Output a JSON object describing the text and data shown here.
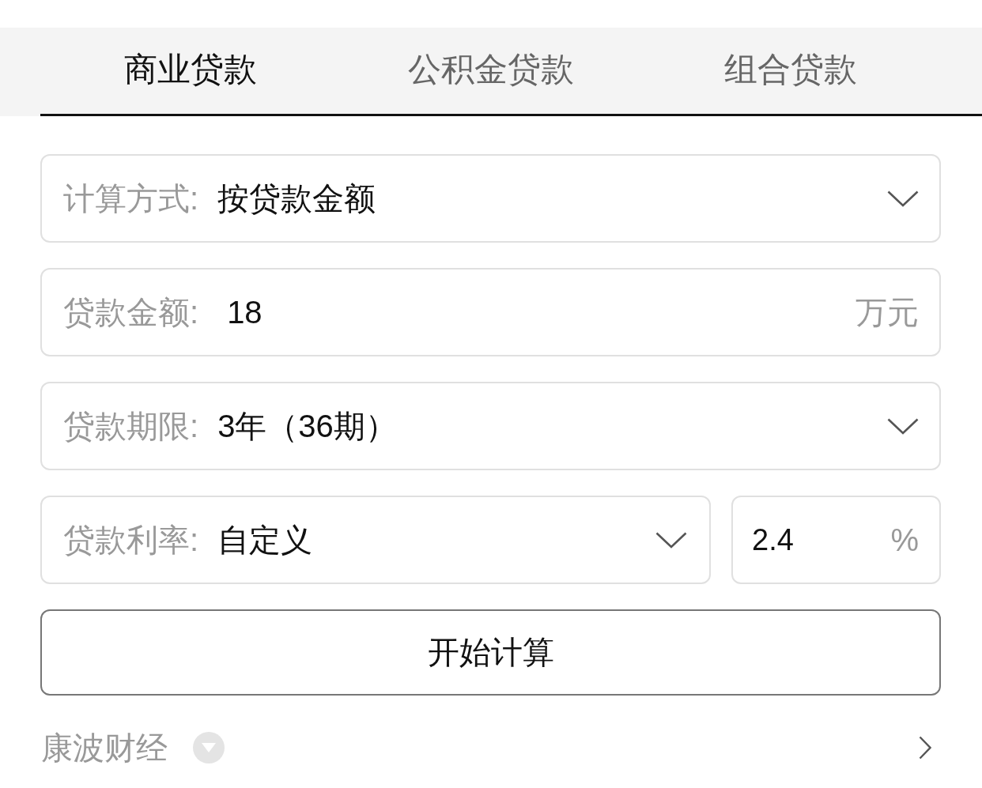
{
  "tabs": [
    {
      "label": "商业贷款",
      "selected": true
    },
    {
      "label": "公积金贷款",
      "selected": false
    },
    {
      "label": "组合贷款",
      "selected": false
    }
  ],
  "form": {
    "fields": [
      {
        "kind": "select",
        "label": "计算方式:",
        "value": "按贷款金额"
      },
      {
        "kind": "input",
        "label": "贷款金额:",
        "value": "18",
        "unit": "万元"
      },
      {
        "kind": "select",
        "label": "贷款期限:",
        "value": "3年（36期）"
      }
    ],
    "rate": {
      "label": "贷款利率:",
      "value": "自定义",
      "custom_value": "2.4",
      "unit": "%"
    }
  },
  "submit_button": "开始计算",
  "footer": {
    "source": "康波财经"
  }
}
